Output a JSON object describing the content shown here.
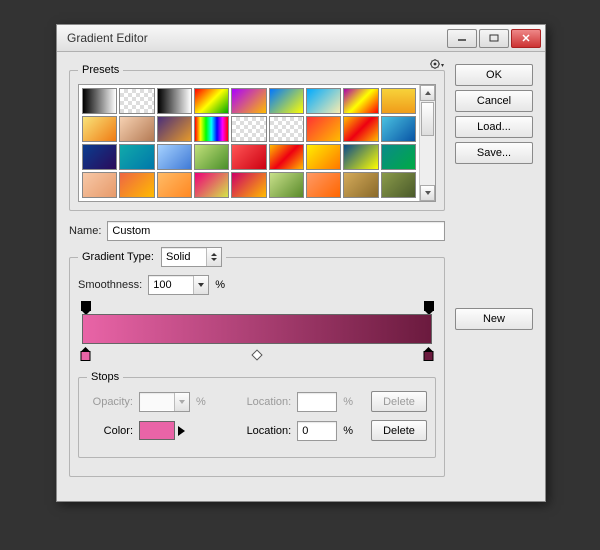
{
  "window": {
    "title": "Gradient Editor"
  },
  "buttons": {
    "ok": "OK",
    "cancel": "Cancel",
    "load": "Load...",
    "save": "Save...",
    "new": "New",
    "delete": "Delete"
  },
  "labels": {
    "presets": "Presets",
    "name": "Name:",
    "gradient_type": "Gradient Type:",
    "smoothness": "Smoothness:",
    "percent": "%",
    "stops": "Stops",
    "opacity": "Opacity:",
    "location": "Location:",
    "color": "Color:"
  },
  "values": {
    "name": "Custom",
    "gradient_type": "Solid",
    "smoothness": "100",
    "opacity_location": "",
    "opacity_value": "",
    "color_location": "0"
  },
  "gradient": {
    "start": "#e964a7",
    "end": "#6b1a3e",
    "stops": [
      {
        "pos": 0,
        "color": "#e964a7"
      },
      {
        "pos": 100,
        "color": "#6b1a3e"
      }
    ],
    "opacity_stops": [
      {
        "pos": 0
      },
      {
        "pos": 100
      }
    ],
    "selected_color": "#e964a7"
  },
  "presets": [
    "linear-gradient(90deg,#000,#fff)",
    "repeating-conic-gradient(#ddd 0 25%,#fff 0 50%) 0 0/8px 8px",
    "linear-gradient(90deg,#000,#fff)",
    "linear-gradient(135deg,#f00,#ff0,#0a0)",
    "linear-gradient(135deg,#a0f,#fb0)",
    "linear-gradient(135deg,#07f,#ff0)",
    "linear-gradient(135deg,#0af,#f8ecae)",
    "linear-gradient(135deg,#a0a,#ff0,#f00)",
    "linear-gradient(180deg,#f7d23a,#f09c1a)",
    "linear-gradient(135deg,#f9e37a,#ef7b13)",
    "linear-gradient(135deg,#f6d1b2,#b47a54)",
    "linear-gradient(135deg,#4a2f7a,#e69a2a)",
    "linear-gradient(90deg,#f00,#ff0,#0f0,#0ff,#00f,#f0f,#f00)",
    "repeating-conic-gradient(#ddd 0 25%,#fff 0 50%) 0 0/8px 8px",
    "repeating-conic-gradient(#ddd 0 25%,#fff 0 50%) 0 0/8px 8px",
    "linear-gradient(135deg,#f33,#fb0)",
    "linear-gradient(135deg,#fb0,#e01,#fb0)",
    "linear-gradient(135deg,#4ac1e0,#0854a5)",
    "linear-gradient(135deg,#0a3d8f,#2b0a5a)",
    "linear-gradient(135deg,#1aa,#07a)",
    "linear-gradient(135deg,#a6d2ff,#407ad6)",
    "linear-gradient(135deg,#c2e07a,#4a8f2a)",
    "linear-gradient(135deg,#f55,#c01)",
    "linear-gradient(135deg,#fb0,#e01,#fb0)",
    "linear-gradient(135deg,#fe0,#f70)",
    "linear-gradient(135deg,#0a4a8a,#ff0)",
    "linear-gradient(135deg,#0a8a8a,#0a4)",
    "linear-gradient(135deg,#f7c8a7,#e79a6a)",
    "linear-gradient(135deg,#e64,#fb0)",
    "linear-gradient(135deg,#fb6,#f82)",
    "linear-gradient(135deg,#e07,#d3e54a)",
    "linear-gradient(135deg,#c06,#fb0)",
    "linear-gradient(135deg,#c8e08a,#5a8a2a)",
    "linear-gradient(135deg,#f96,#f60)",
    "linear-gradient(135deg,#d4aa5a,#8a6a2a)",
    "linear-gradient(135deg,#8a9a4a,#4a5a2a)"
  ]
}
